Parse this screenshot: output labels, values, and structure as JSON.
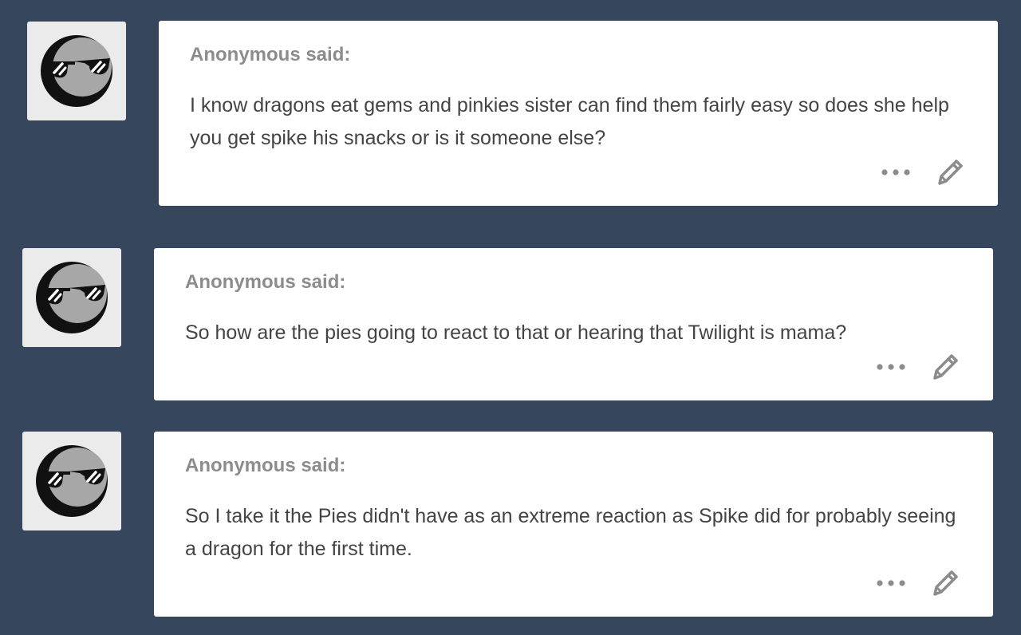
{
  "posts": [
    {
      "asker": "Anonymous said:",
      "question": "I know dragons eat gems and pinkies sister can find them fairly easy so does she help you get spike his snacks or is it someone else?",
      "avatar_icon": "anonymous-sunglasses-avatar",
      "actions": [
        "more-options-icon",
        "edit-pencil-icon"
      ]
    },
    {
      "asker": "Anonymous said:",
      "question": "So how are the pies going to react to that or hearing that Twilight is mama?",
      "avatar_icon": "anonymous-sunglasses-avatar",
      "actions": [
        "more-options-icon",
        "edit-pencil-icon"
      ]
    },
    {
      "asker": "Anonymous said:",
      "question": "So I take it the Pies didn't have as an extreme reaction as Spike did for probably seeing a dragon for the first time.",
      "avatar_icon": "anonymous-sunglasses-avatar",
      "actions": [
        "more-options-icon",
        "edit-pencil-icon"
      ]
    }
  ],
  "colors": {
    "background": "#36465d",
    "card": "#ffffff",
    "asker_text": "#8c8c8c",
    "body_text": "#444444",
    "icon": "#8c8c8c"
  }
}
